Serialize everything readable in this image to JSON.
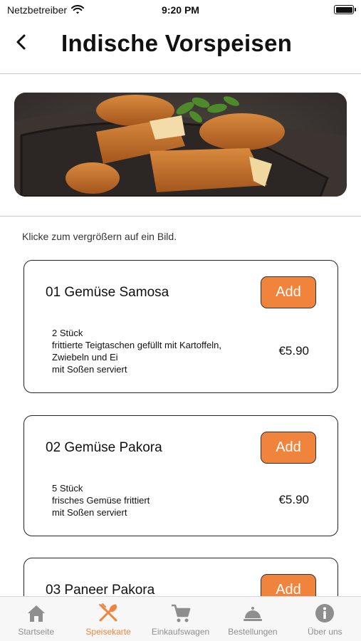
{
  "status_bar": {
    "carrier": "Netzbetreiber",
    "time": "9:20 PM"
  },
  "header": {
    "title": "Indische Vorspeisen",
    "back_icon": "chevron-left-icon"
  },
  "hint": "Klicke zum vergrößern auf ein Bild.",
  "accent_color": "#f0843c",
  "menu_items": [
    {
      "name": "01 Gemüse Samosa",
      "add_label": "Add",
      "description": [
        "2 Stück",
        "frittierte Teigtaschen gefüllt mit Kartoffeln,",
        "Zwiebeln und Ei",
        "mit Soßen serviert"
      ],
      "price": "€5.90"
    },
    {
      "name": "02 Gemüse Pakora",
      "add_label": "Add",
      "description": [
        "5 Stück",
        "frisches Gemüse frittiert",
        "mit Soßen serviert"
      ],
      "price": "€5.90"
    },
    {
      "name": "03 Paneer Pakora",
      "add_label": "Add"
    }
  ],
  "tabs": [
    {
      "label": "Startseite",
      "icon": "home-icon",
      "active": false
    },
    {
      "label": "Speisekarte",
      "icon": "fork-knife-icon",
      "active": true
    },
    {
      "label": "Einkaufswagen",
      "icon": "cart-icon",
      "active": false
    },
    {
      "label": "Bestellungen",
      "icon": "cloche-icon",
      "active": false
    },
    {
      "label": "Über uns",
      "icon": "info-icon",
      "active": false
    }
  ]
}
